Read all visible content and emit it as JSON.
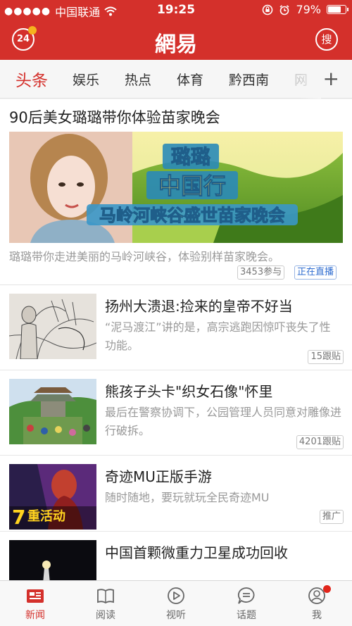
{
  "status": {
    "carrier": "中国联通",
    "time": "19:25",
    "battery": "79%",
    "battery_level": 0.79
  },
  "header": {
    "logo": "網易",
    "badge_24": "24",
    "search_label": "搜"
  },
  "tabs": [
    {
      "label": "头条",
      "active": true
    },
    {
      "label": "娱乐"
    },
    {
      "label": "热点"
    },
    {
      "label": "体育"
    },
    {
      "label": "黔西南"
    },
    {
      "label": "网"
    }
  ],
  "featured": {
    "title": "90后美女璐璐带你体验苗家晚会",
    "banner_line1": "璐璐",
    "banner_line2": "中国行",
    "banner_line3": "马岭河峡谷盛世苗家晚会",
    "description": "璐璐带你走进美丽的马岭河峡谷，体验别样苗家晚会。",
    "participants": "3453参与",
    "live_tag": "正在直播"
  },
  "items": [
    {
      "title": "扬州大溃退:捡来的皇帝不好当",
      "description": "“泥马渡江”讲的是，高宗逃跑因惊吓丧失了性功能。",
      "count": "15跟贴"
    },
    {
      "title": "熊孩子头卡\"织女石像\"怀里",
      "description": "最后在警察协调下，公园管理人员同意对雕像进行破拆。",
      "count": "4201跟贴"
    },
    {
      "title": "奇迹MU正版手游",
      "description": "随时随地，要玩就玩全民奇迹MU",
      "count": "推广",
      "thumb_text": "7重活动"
    },
    {
      "title": "中国首颗微重力卫星成功回收",
      "description": "",
      "count": ""
    }
  ],
  "bottom_nav": [
    {
      "label": "新闻",
      "icon": "news-icon",
      "active": true
    },
    {
      "label": "阅读",
      "icon": "book-icon"
    },
    {
      "label": "视听",
      "icon": "play-icon"
    },
    {
      "label": "话题",
      "icon": "chat-icon"
    },
    {
      "label": "我",
      "icon": "user-icon",
      "badge": true
    }
  ],
  "colors": {
    "brand": "#d4302b",
    "live": "#2e6cd0"
  }
}
